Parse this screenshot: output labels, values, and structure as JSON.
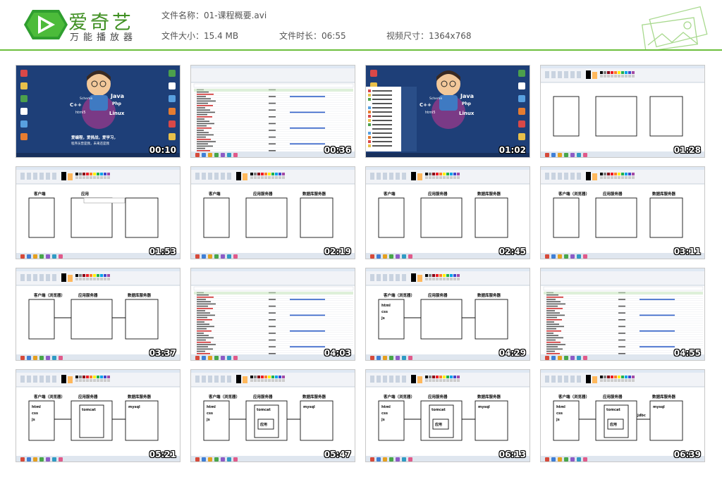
{
  "brand": {
    "name": "爱奇艺",
    "tagline": "万能播放器",
    "accent_color": "#6cbf3c"
  },
  "file_info": {
    "name_label": "文件名称：",
    "name_value": "01-课程概要.avi",
    "size_label": "文件大小：",
    "size_value": "15.4 MB",
    "duration_label": "文件时长：",
    "duration_value": "06:55",
    "resolution_label": "视频尺寸：",
    "resolution_value": "1364x768"
  },
  "thumbnails": [
    {
      "timestamp": "00:10",
      "scene": "desktop",
      "texts": [
        "Java",
        "Scheme",
        "Php",
        "C++",
        "html5",
        "Linux",
        "爱编程，爱挑战，爱学习，",
        "程序员曾是我，未来还是我"
      ]
    },
    {
      "timestamp": "00:36",
      "scene": "spreadsheet",
      "texts": []
    },
    {
      "timestamp": "01:02",
      "scene": "desktop-menu",
      "texts": [
        "Java",
        "Scheme",
        "Php",
        "C++",
        "html5",
        "Linux"
      ]
    },
    {
      "timestamp": "01:28",
      "scene": "paint",
      "texts": []
    },
    {
      "timestamp": "01:53",
      "scene": "paint",
      "texts": [
        "客户端",
        "应用"
      ]
    },
    {
      "timestamp": "02:19",
      "scene": "paint",
      "texts": [
        "客户端",
        "应用服务器",
        "数据库服务器"
      ]
    },
    {
      "timestamp": "02:45",
      "scene": "paint",
      "texts": [
        "客户端",
        "应用服务器",
        "数据库服务器"
      ]
    },
    {
      "timestamp": "03:11",
      "scene": "paint",
      "texts": [
        "客户端（浏览器）",
        "应用服务器",
        "数据库服务器"
      ]
    },
    {
      "timestamp": "03:37",
      "scene": "paint",
      "texts": [
        "客户端（浏览器）",
        "应用服务器",
        "数据库服务器"
      ]
    },
    {
      "timestamp": "04:03",
      "scene": "spreadsheet",
      "texts": []
    },
    {
      "timestamp": "04:29",
      "scene": "paint",
      "texts": [
        "客户端（浏览器）",
        "应用服务器",
        "数据库服务器",
        "html",
        "css",
        "js"
      ]
    },
    {
      "timestamp": "04:55",
      "scene": "spreadsheet",
      "texts": []
    },
    {
      "timestamp": "05:21",
      "scene": "paint",
      "texts": [
        "客户端（浏览器）",
        "应用服务器",
        "数据库服务器",
        "html",
        "css",
        "js",
        "tomcat",
        "mysql"
      ]
    },
    {
      "timestamp": "05:47",
      "scene": "paint",
      "texts": [
        "客户端（浏览器）",
        "应用服务器",
        "数据库服务器",
        "html",
        "css",
        "js",
        "tomcat",
        "mysql",
        "应用"
      ]
    },
    {
      "timestamp": "06:13",
      "scene": "paint",
      "texts": [
        "客户端（浏览器）",
        "应用服务器",
        "数据库服务器",
        "html",
        "css",
        "js",
        "tomcat",
        "mysql",
        "应用"
      ]
    },
    {
      "timestamp": "06:39",
      "scene": "paint",
      "texts": [
        "客户端（浏览器）",
        "应用服务器",
        "数据库服务器",
        "html",
        "css",
        "js",
        "tomcat",
        "mysql",
        "应用",
        "jdbc"
      ]
    }
  ]
}
